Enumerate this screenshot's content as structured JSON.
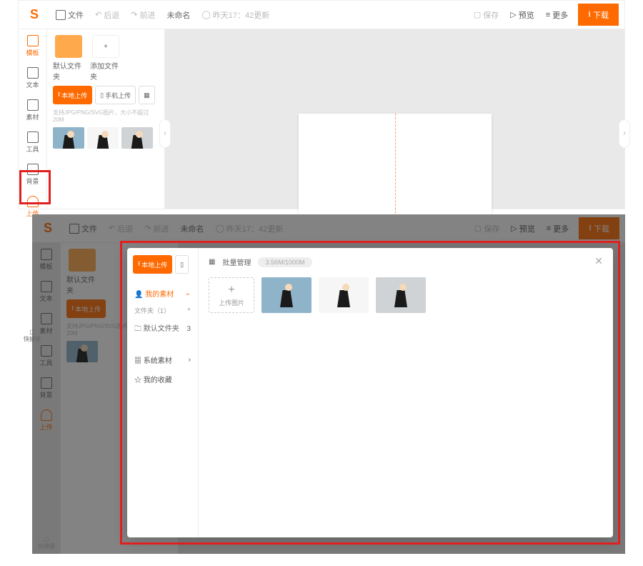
{
  "topbar": {
    "file": "文件",
    "undo": "后退",
    "redo": "前进",
    "title": "未命名",
    "autosave": "昨天17：42更新",
    "save": "保存",
    "preview": "预览",
    "more": "更多",
    "download": "下载"
  },
  "leftnav": {
    "template": "模板",
    "text": "文本",
    "material": "素材",
    "tool": "工具",
    "background": "背景",
    "upload": "上传"
  },
  "sidepanel": {
    "folder_default": "默认文件夹",
    "folder_add": "添加文件夹",
    "btn_local": "本地上传",
    "btn_phone": "手机上传",
    "hint": "支持JPG/PNG/SVG图片，大小不超过20M"
  },
  "shortcut": "快捷键",
  "modal": {
    "left": {
      "btn_local": "本地上传",
      "my_material": "我的素材",
      "files_count": "文件夹（1）",
      "folder_default": "默认文件夹",
      "folder_count": "3",
      "system_material": "系统素材",
      "my_fav": "我的收藏"
    },
    "main": {
      "batch": "批量管理",
      "storage": "3.56M/1000M",
      "upload_tile": "上传图片"
    }
  }
}
